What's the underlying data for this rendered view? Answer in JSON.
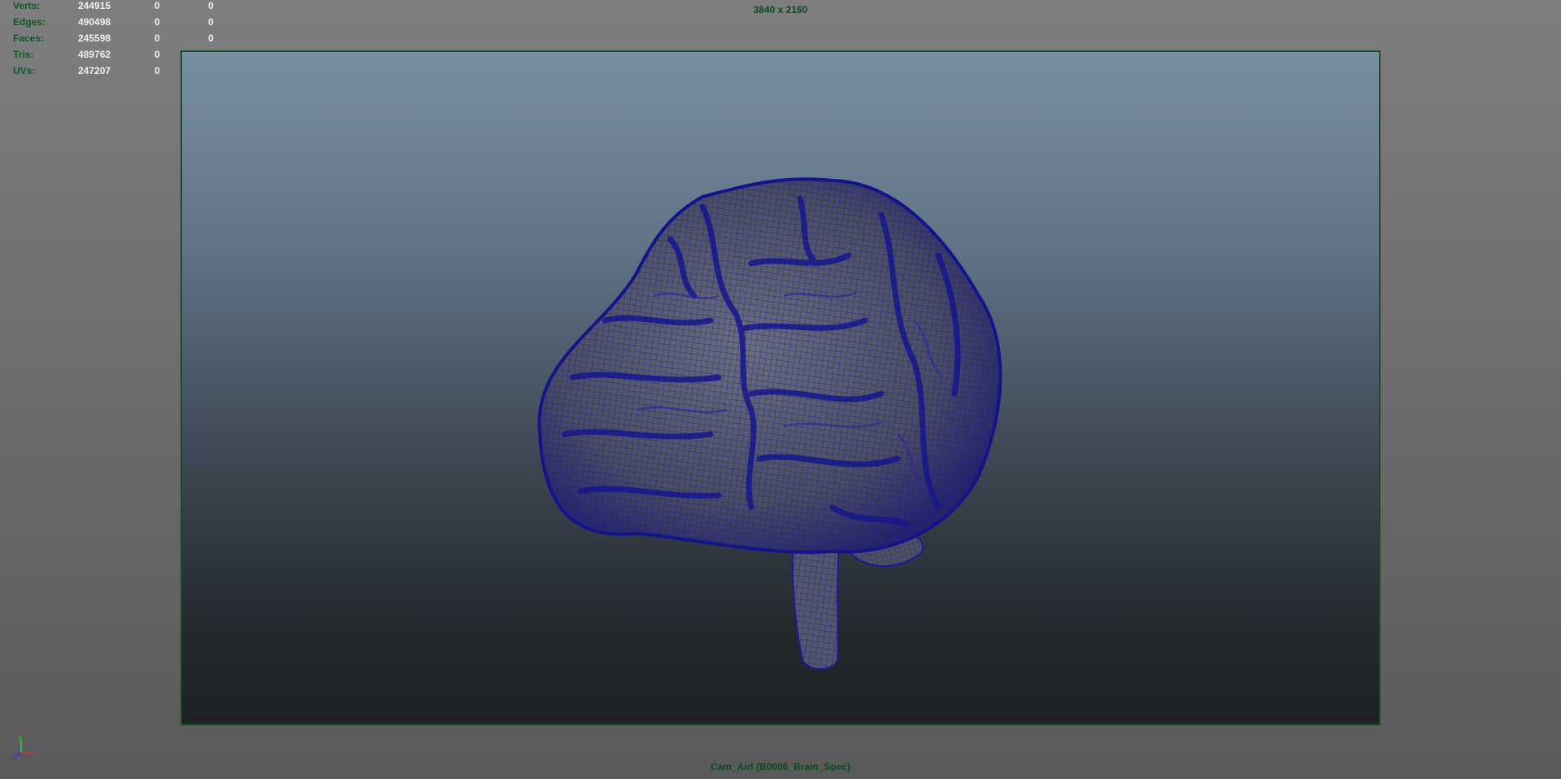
{
  "hud": {
    "rows": [
      {
        "label": "Verts:",
        "v1": "244915",
        "v2": "0",
        "v3": "0"
      },
      {
        "label": "Edges:",
        "v1": "490498",
        "v2": "0",
        "v3": "0"
      },
      {
        "label": "Faces:",
        "v1": "245598",
        "v2": "0",
        "v3": "0"
      },
      {
        "label": "Tris:",
        "v1": "489762",
        "v2": "0",
        "v3": "0"
      },
      {
        "label": "UVs:",
        "v1": "247207",
        "v2": "0",
        "v3": "0"
      }
    ]
  },
  "resolution": "3840 x 2160",
  "camera": "Cam_Airl (B0006_Brain_Spec)",
  "axis": {
    "y": "y",
    "z": "z",
    "x": "x"
  },
  "colors": {
    "hud_label": "#0a5a22",
    "hud_value": "#f0f0f0",
    "wireframe": "#1a1a9a",
    "gate_border": "#1c4a2a"
  }
}
